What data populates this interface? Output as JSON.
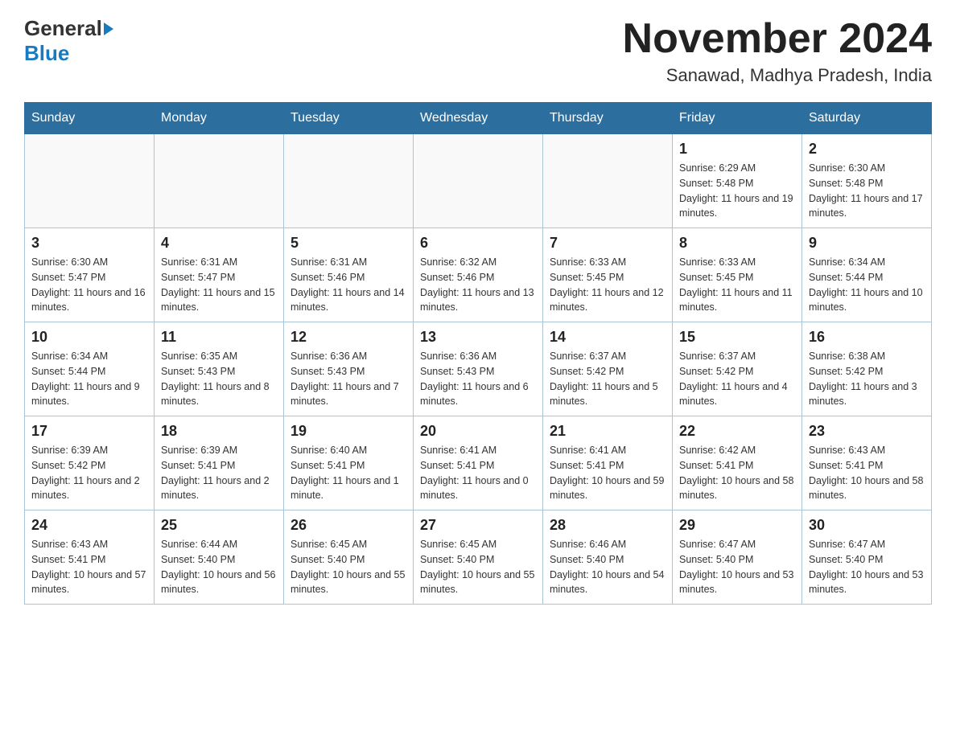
{
  "header": {
    "month_title": "November 2024",
    "location": "Sanawad, Madhya Pradesh, India",
    "logo_general": "General",
    "logo_blue": "Blue"
  },
  "weekdays": [
    "Sunday",
    "Monday",
    "Tuesday",
    "Wednesday",
    "Thursday",
    "Friday",
    "Saturday"
  ],
  "weeks": [
    [
      {
        "day": "",
        "info": ""
      },
      {
        "day": "",
        "info": ""
      },
      {
        "day": "",
        "info": ""
      },
      {
        "day": "",
        "info": ""
      },
      {
        "day": "",
        "info": ""
      },
      {
        "day": "1",
        "info": "Sunrise: 6:29 AM\nSunset: 5:48 PM\nDaylight: 11 hours and 19 minutes."
      },
      {
        "day": "2",
        "info": "Sunrise: 6:30 AM\nSunset: 5:48 PM\nDaylight: 11 hours and 17 minutes."
      }
    ],
    [
      {
        "day": "3",
        "info": "Sunrise: 6:30 AM\nSunset: 5:47 PM\nDaylight: 11 hours and 16 minutes."
      },
      {
        "day": "4",
        "info": "Sunrise: 6:31 AM\nSunset: 5:47 PM\nDaylight: 11 hours and 15 minutes."
      },
      {
        "day": "5",
        "info": "Sunrise: 6:31 AM\nSunset: 5:46 PM\nDaylight: 11 hours and 14 minutes."
      },
      {
        "day": "6",
        "info": "Sunrise: 6:32 AM\nSunset: 5:46 PM\nDaylight: 11 hours and 13 minutes."
      },
      {
        "day": "7",
        "info": "Sunrise: 6:33 AM\nSunset: 5:45 PM\nDaylight: 11 hours and 12 minutes."
      },
      {
        "day": "8",
        "info": "Sunrise: 6:33 AM\nSunset: 5:45 PM\nDaylight: 11 hours and 11 minutes."
      },
      {
        "day": "9",
        "info": "Sunrise: 6:34 AM\nSunset: 5:44 PM\nDaylight: 11 hours and 10 minutes."
      }
    ],
    [
      {
        "day": "10",
        "info": "Sunrise: 6:34 AM\nSunset: 5:44 PM\nDaylight: 11 hours and 9 minutes."
      },
      {
        "day": "11",
        "info": "Sunrise: 6:35 AM\nSunset: 5:43 PM\nDaylight: 11 hours and 8 minutes."
      },
      {
        "day": "12",
        "info": "Sunrise: 6:36 AM\nSunset: 5:43 PM\nDaylight: 11 hours and 7 minutes."
      },
      {
        "day": "13",
        "info": "Sunrise: 6:36 AM\nSunset: 5:43 PM\nDaylight: 11 hours and 6 minutes."
      },
      {
        "day": "14",
        "info": "Sunrise: 6:37 AM\nSunset: 5:42 PM\nDaylight: 11 hours and 5 minutes."
      },
      {
        "day": "15",
        "info": "Sunrise: 6:37 AM\nSunset: 5:42 PM\nDaylight: 11 hours and 4 minutes."
      },
      {
        "day": "16",
        "info": "Sunrise: 6:38 AM\nSunset: 5:42 PM\nDaylight: 11 hours and 3 minutes."
      }
    ],
    [
      {
        "day": "17",
        "info": "Sunrise: 6:39 AM\nSunset: 5:42 PM\nDaylight: 11 hours and 2 minutes."
      },
      {
        "day": "18",
        "info": "Sunrise: 6:39 AM\nSunset: 5:41 PM\nDaylight: 11 hours and 2 minutes."
      },
      {
        "day": "19",
        "info": "Sunrise: 6:40 AM\nSunset: 5:41 PM\nDaylight: 11 hours and 1 minute."
      },
      {
        "day": "20",
        "info": "Sunrise: 6:41 AM\nSunset: 5:41 PM\nDaylight: 11 hours and 0 minutes."
      },
      {
        "day": "21",
        "info": "Sunrise: 6:41 AM\nSunset: 5:41 PM\nDaylight: 10 hours and 59 minutes."
      },
      {
        "day": "22",
        "info": "Sunrise: 6:42 AM\nSunset: 5:41 PM\nDaylight: 10 hours and 58 minutes."
      },
      {
        "day": "23",
        "info": "Sunrise: 6:43 AM\nSunset: 5:41 PM\nDaylight: 10 hours and 58 minutes."
      }
    ],
    [
      {
        "day": "24",
        "info": "Sunrise: 6:43 AM\nSunset: 5:41 PM\nDaylight: 10 hours and 57 minutes."
      },
      {
        "day": "25",
        "info": "Sunrise: 6:44 AM\nSunset: 5:40 PM\nDaylight: 10 hours and 56 minutes."
      },
      {
        "day": "26",
        "info": "Sunrise: 6:45 AM\nSunset: 5:40 PM\nDaylight: 10 hours and 55 minutes."
      },
      {
        "day": "27",
        "info": "Sunrise: 6:45 AM\nSunset: 5:40 PM\nDaylight: 10 hours and 55 minutes."
      },
      {
        "day": "28",
        "info": "Sunrise: 6:46 AM\nSunset: 5:40 PM\nDaylight: 10 hours and 54 minutes."
      },
      {
        "day": "29",
        "info": "Sunrise: 6:47 AM\nSunset: 5:40 PM\nDaylight: 10 hours and 53 minutes."
      },
      {
        "day": "30",
        "info": "Sunrise: 6:47 AM\nSunset: 5:40 PM\nDaylight: 10 hours and 53 minutes."
      }
    ]
  ]
}
